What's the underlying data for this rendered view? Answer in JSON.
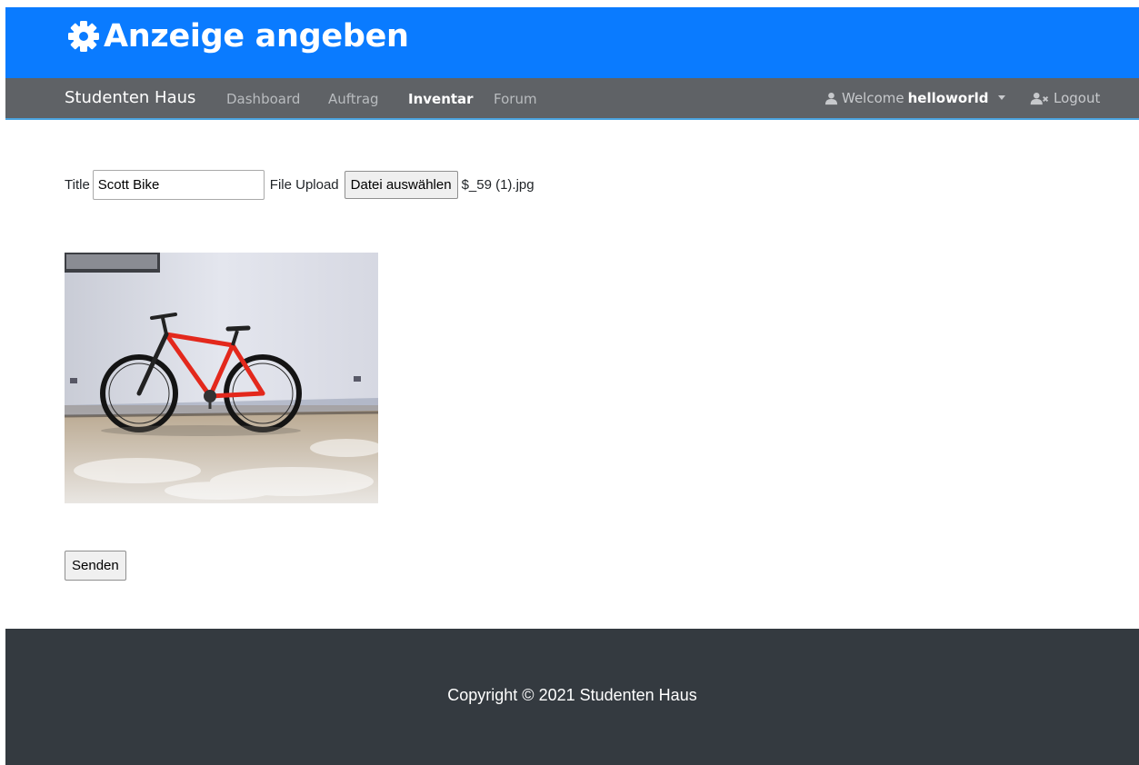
{
  "header": {
    "title": "Anzeige angeben",
    "icon": "gear-icon",
    "background": "#0a7bff"
  },
  "navbar": {
    "brand": "Studenten Haus",
    "links": [
      {
        "label": "Dashboard",
        "active": false
      },
      {
        "label": "Auftrag",
        "active": false
      },
      {
        "label": "Inventar",
        "active": true
      },
      {
        "label": "Forum",
        "active": false
      }
    ],
    "welcome_prefix": "Welcome",
    "username": "helloworld",
    "logout_label": "Logout",
    "background": "#5f6266",
    "accent_border": "#4aa3df"
  },
  "form": {
    "title_label": "Title",
    "title_value": "Scott Bike",
    "file_label": "File Upload",
    "file_button": "Datei auswählen",
    "file_name": "$_59 (1).jpg",
    "submit_label": "Senden"
  },
  "preview": {
    "subject": "red mountain bike leaning against white wall"
  },
  "footer": {
    "text": "Copyright © 2021 Studenten Haus",
    "background": "#343a40"
  }
}
